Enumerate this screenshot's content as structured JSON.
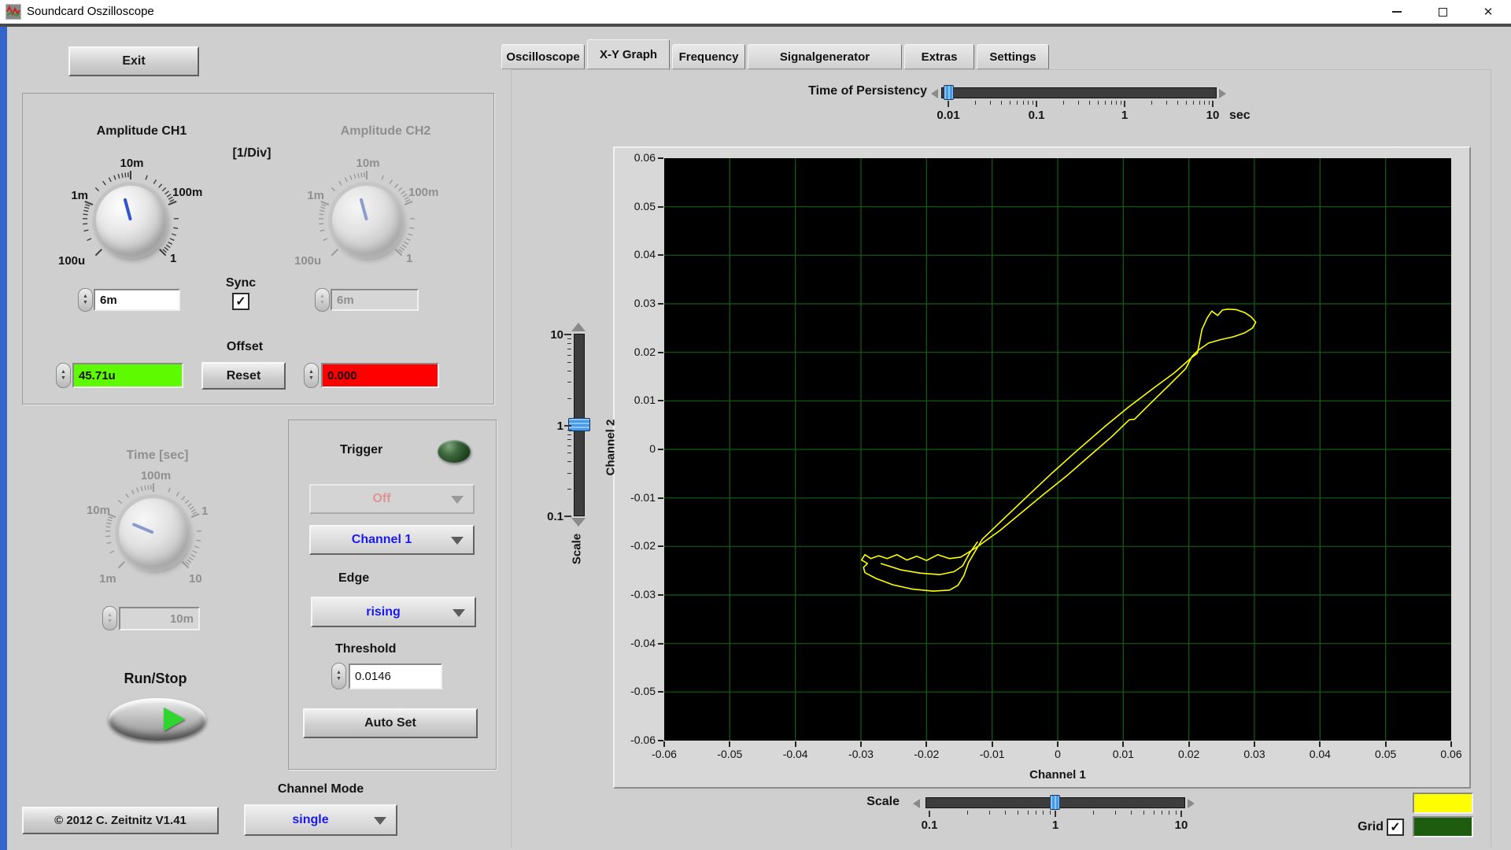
{
  "window": {
    "title": "Soundcard Oszilloscope",
    "close_glyph": "✕"
  },
  "left_panel": {
    "exit": "Exit",
    "amplitude": {
      "ch1_title": "Amplitude CH1",
      "div_label": "[1/Div]",
      "ch2_title": "Amplitude CH2",
      "knob_scale": {
        "min": "100u",
        "low": "1m",
        "mid": "10m",
        "high": "100m",
        "max": "1"
      },
      "ch1_value": "6m",
      "ch2_value": "6m",
      "sync": {
        "label": "Sync",
        "checked": "✓"
      },
      "offset": {
        "label": "Offset",
        "ch1_value": "45.71u",
        "ch1_bg": "#5dfa00",
        "reset": "Reset",
        "ch2_value": "0.000",
        "ch2_bg": "#ff0000"
      }
    },
    "time": {
      "title": "Time [sec]",
      "scale": {
        "min": "1m",
        "low": "10m",
        "mid": "100m",
        "high": "1",
        "max": "10"
      },
      "value": "10m"
    },
    "run_stop": {
      "label": "Run/Stop"
    },
    "copyright": "© 2012   C. Zeitnitz V1.41"
  },
  "trigger": {
    "title": "Trigger",
    "mode": "Off",
    "source": "Channel 1",
    "edge_label": "Edge",
    "edge": "rising",
    "threshold_label": "Threshold",
    "threshold_value": "0.0146",
    "auto_set": "Auto Set"
  },
  "channel_mode": {
    "label": "Channel Mode",
    "value": "single"
  },
  "tabs": {
    "items": [
      "Oscilloscope",
      "X-Y Graph",
      "Frequency",
      "Signalgenerator",
      "Extras",
      "Settings"
    ],
    "active": "X-Y Graph"
  },
  "persistency": {
    "label": "Time of Persistency",
    "tick_labels": [
      "0.01",
      "0.1",
      "1",
      "10"
    ],
    "unit": "sec"
  },
  "vertical_scale": {
    "label": "Scale",
    "tick_labels": [
      "10",
      "1",
      "0.1"
    ]
  },
  "horizontal_scale": {
    "label": "Scale",
    "tick_labels": [
      "0.1",
      "1",
      "10"
    ]
  },
  "grid_control": {
    "label": "Grid",
    "checked": "✓",
    "trace_color": "#ffff00",
    "grid_color": "#1e5c10"
  },
  "chart_data": {
    "type": "line",
    "title": "",
    "xlabel": "Channel 1",
    "ylabel": "Channel 2",
    "xlim": [
      -0.06,
      0.06
    ],
    "ylim": [
      -0.06,
      0.06
    ],
    "grid": true,
    "grid_step": 0.01,
    "background": "#000000",
    "grid_color": "#135f13",
    "trace_color": "#ffff00",
    "x_ticks": [
      "-0.06",
      "-0.05",
      "-0.04",
      "-0.03",
      "-0.02",
      "-0.01",
      "0",
      "0.01",
      "0.02",
      "0.03",
      "0.04",
      "0.05",
      "0.06"
    ],
    "y_ticks": [
      "0.06",
      "0.05",
      "0.04",
      "0.03",
      "0.02",
      "0.01",
      "0",
      "-0.01",
      "-0.02",
      "-0.03",
      "-0.04",
      "-0.05",
      "-0.06"
    ],
    "series": [
      {
        "name": "xy-trace",
        "points": [
          [
            0.0213,
            0.0198
          ],
          [
            0.022,
            0.0247
          ],
          [
            0.0228,
            0.0271
          ],
          [
            0.0235,
            0.0285
          ],
          [
            0.0244,
            0.0276
          ],
          [
            0.0251,
            0.0287
          ],
          [
            0.0259,
            0.0289
          ],
          [
            0.0272,
            0.0288
          ],
          [
            0.0285,
            0.0282
          ],
          [
            0.0295,
            0.0273
          ],
          [
            0.0302,
            0.0262
          ],
          [
            0.0297,
            0.025
          ],
          [
            0.0285,
            0.024
          ],
          [
            0.0268,
            0.0232
          ],
          [
            0.0248,
            0.0226
          ],
          [
            0.023,
            0.0219
          ],
          [
            0.0215,
            0.0205
          ],
          [
            0.0205,
            0.0192
          ],
          [
            0.0195,
            0.0166
          ],
          [
            0.0169,
            0.0131
          ],
          [
            0.0143,
            0.0097
          ],
          [
            0.0117,
            0.0062
          ],
          [
            0.0109,
            0.0061
          ],
          [
            0.0083,
            0.0027
          ],
          [
            0.0049,
            -0.0013
          ],
          [
            0.0015,
            -0.0053
          ],
          [
            -0.002,
            -0.0091
          ],
          [
            -0.0054,
            -0.0129
          ],
          [
            -0.0088,
            -0.0167
          ],
          [
            -0.0123,
            -0.0201
          ],
          [
            -0.0148,
            -0.0222
          ],
          [
            -0.0165,
            -0.0225
          ],
          [
            -0.0183,
            -0.0217
          ],
          [
            -0.02,
            -0.0229
          ],
          [
            -0.0215,
            -0.022
          ],
          [
            -0.023,
            -0.0228
          ],
          [
            -0.0245,
            -0.0217
          ],
          [
            -0.026,
            -0.0225
          ],
          [
            -0.0273,
            -0.0219
          ],
          [
            -0.0285,
            -0.0225
          ],
          [
            -0.0294,
            -0.0217
          ],
          [
            -0.0299,
            -0.0228
          ],
          [
            -0.029,
            -0.0235
          ],
          [
            -0.0296,
            -0.0243
          ],
          [
            -0.0294,
            -0.0254
          ],
          [
            -0.0277,
            -0.0266
          ],
          [
            -0.0251,
            -0.0279
          ],
          [
            -0.0221,
            -0.0288
          ],
          [
            -0.019,
            -0.0292
          ],
          [
            -0.0165,
            -0.029
          ],
          [
            -0.0152,
            -0.028
          ],
          [
            -0.0143,
            -0.026
          ],
          [
            -0.0136,
            -0.0233
          ],
          [
            -0.0115,
            -0.0185
          ],
          [
            -0.008,
            -0.014
          ],
          [
            -0.0045,
            -0.0095
          ],
          [
            -0.0008,
            -0.0048
          ],
          [
            0.003,
            -0.0002
          ],
          [
            0.007,
            0.0045
          ],
          [
            0.0108,
            0.0087
          ],
          [
            0.0145,
            0.0125
          ],
          [
            0.0178,
            0.0158
          ],
          [
            0.0205,
            0.019
          ],
          [
            0.0213,
            0.0198
          ]
        ]
      },
      {
        "name": "xy-trace-inner",
        "points": [
          [
            -0.027,
            -0.0235
          ],
          [
            -0.024,
            -0.0248
          ],
          [
            -0.021,
            -0.0255
          ],
          [
            -0.018,
            -0.0258
          ],
          [
            -0.0158,
            -0.0252
          ],
          [
            -0.0145,
            -0.024
          ],
          [
            -0.0135,
            -0.0215
          ],
          [
            -0.0122,
            -0.019
          ]
        ]
      }
    ]
  }
}
